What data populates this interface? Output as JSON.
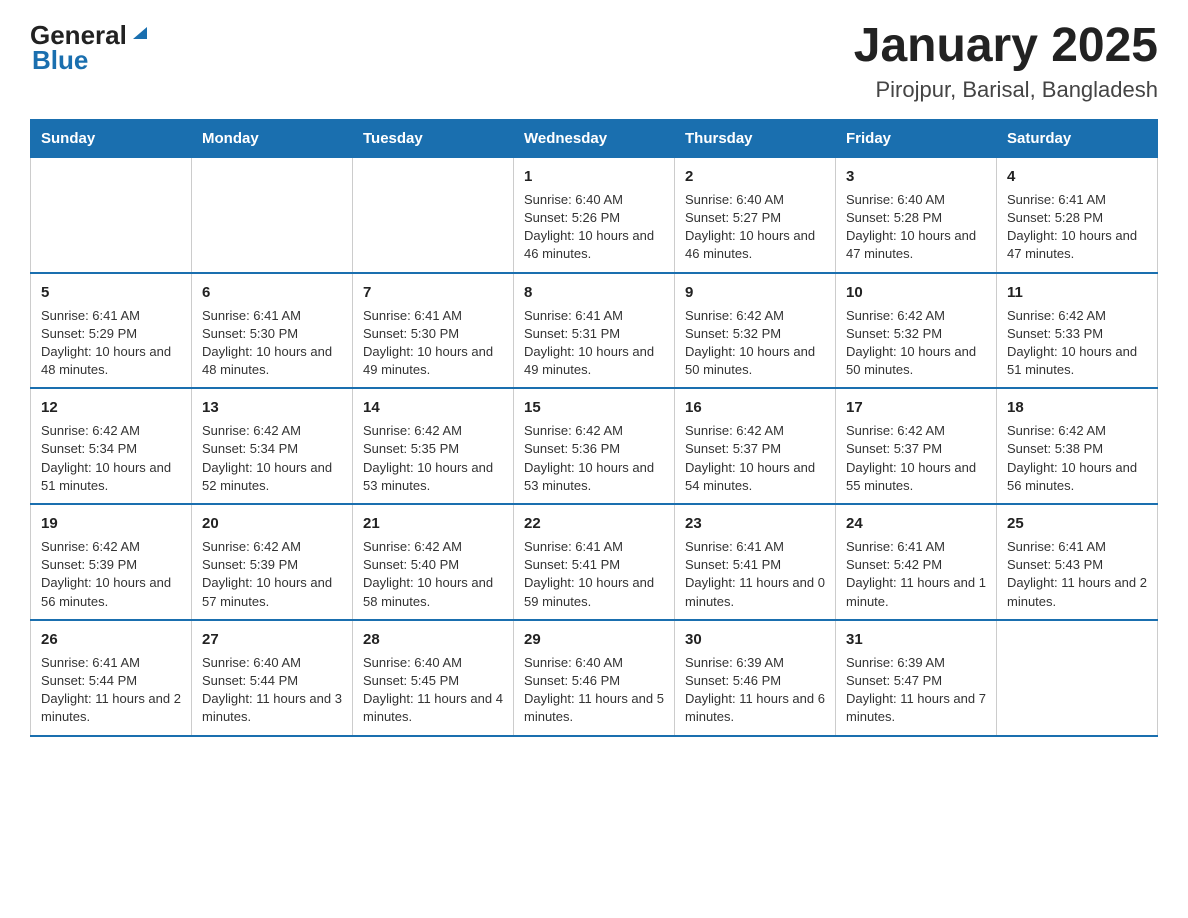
{
  "header": {
    "logo_general": "General",
    "logo_blue": "Blue",
    "title": "January 2025",
    "subtitle": "Pirojpur, Barisal, Bangladesh"
  },
  "days_of_week": [
    "Sunday",
    "Monday",
    "Tuesday",
    "Wednesday",
    "Thursday",
    "Friday",
    "Saturday"
  ],
  "weeks": [
    [
      {
        "day": "",
        "info": ""
      },
      {
        "day": "",
        "info": ""
      },
      {
        "day": "",
        "info": ""
      },
      {
        "day": "1",
        "info": "Sunrise: 6:40 AM\nSunset: 5:26 PM\nDaylight: 10 hours and 46 minutes."
      },
      {
        "day": "2",
        "info": "Sunrise: 6:40 AM\nSunset: 5:27 PM\nDaylight: 10 hours and 46 minutes."
      },
      {
        "day": "3",
        "info": "Sunrise: 6:40 AM\nSunset: 5:28 PM\nDaylight: 10 hours and 47 minutes."
      },
      {
        "day": "4",
        "info": "Sunrise: 6:41 AM\nSunset: 5:28 PM\nDaylight: 10 hours and 47 minutes."
      }
    ],
    [
      {
        "day": "5",
        "info": "Sunrise: 6:41 AM\nSunset: 5:29 PM\nDaylight: 10 hours and 48 minutes."
      },
      {
        "day": "6",
        "info": "Sunrise: 6:41 AM\nSunset: 5:30 PM\nDaylight: 10 hours and 48 minutes."
      },
      {
        "day": "7",
        "info": "Sunrise: 6:41 AM\nSunset: 5:30 PM\nDaylight: 10 hours and 49 minutes."
      },
      {
        "day": "8",
        "info": "Sunrise: 6:41 AM\nSunset: 5:31 PM\nDaylight: 10 hours and 49 minutes."
      },
      {
        "day": "9",
        "info": "Sunrise: 6:42 AM\nSunset: 5:32 PM\nDaylight: 10 hours and 50 minutes."
      },
      {
        "day": "10",
        "info": "Sunrise: 6:42 AM\nSunset: 5:32 PM\nDaylight: 10 hours and 50 minutes."
      },
      {
        "day": "11",
        "info": "Sunrise: 6:42 AM\nSunset: 5:33 PM\nDaylight: 10 hours and 51 minutes."
      }
    ],
    [
      {
        "day": "12",
        "info": "Sunrise: 6:42 AM\nSunset: 5:34 PM\nDaylight: 10 hours and 51 minutes."
      },
      {
        "day": "13",
        "info": "Sunrise: 6:42 AM\nSunset: 5:34 PM\nDaylight: 10 hours and 52 minutes."
      },
      {
        "day": "14",
        "info": "Sunrise: 6:42 AM\nSunset: 5:35 PM\nDaylight: 10 hours and 53 minutes."
      },
      {
        "day": "15",
        "info": "Sunrise: 6:42 AM\nSunset: 5:36 PM\nDaylight: 10 hours and 53 minutes."
      },
      {
        "day": "16",
        "info": "Sunrise: 6:42 AM\nSunset: 5:37 PM\nDaylight: 10 hours and 54 minutes."
      },
      {
        "day": "17",
        "info": "Sunrise: 6:42 AM\nSunset: 5:37 PM\nDaylight: 10 hours and 55 minutes."
      },
      {
        "day": "18",
        "info": "Sunrise: 6:42 AM\nSunset: 5:38 PM\nDaylight: 10 hours and 56 minutes."
      }
    ],
    [
      {
        "day": "19",
        "info": "Sunrise: 6:42 AM\nSunset: 5:39 PM\nDaylight: 10 hours and 56 minutes."
      },
      {
        "day": "20",
        "info": "Sunrise: 6:42 AM\nSunset: 5:39 PM\nDaylight: 10 hours and 57 minutes."
      },
      {
        "day": "21",
        "info": "Sunrise: 6:42 AM\nSunset: 5:40 PM\nDaylight: 10 hours and 58 minutes."
      },
      {
        "day": "22",
        "info": "Sunrise: 6:41 AM\nSunset: 5:41 PM\nDaylight: 10 hours and 59 minutes."
      },
      {
        "day": "23",
        "info": "Sunrise: 6:41 AM\nSunset: 5:41 PM\nDaylight: 11 hours and 0 minutes."
      },
      {
        "day": "24",
        "info": "Sunrise: 6:41 AM\nSunset: 5:42 PM\nDaylight: 11 hours and 1 minute."
      },
      {
        "day": "25",
        "info": "Sunrise: 6:41 AM\nSunset: 5:43 PM\nDaylight: 11 hours and 2 minutes."
      }
    ],
    [
      {
        "day": "26",
        "info": "Sunrise: 6:41 AM\nSunset: 5:44 PM\nDaylight: 11 hours and 2 minutes."
      },
      {
        "day": "27",
        "info": "Sunrise: 6:40 AM\nSunset: 5:44 PM\nDaylight: 11 hours and 3 minutes."
      },
      {
        "day": "28",
        "info": "Sunrise: 6:40 AM\nSunset: 5:45 PM\nDaylight: 11 hours and 4 minutes."
      },
      {
        "day": "29",
        "info": "Sunrise: 6:40 AM\nSunset: 5:46 PM\nDaylight: 11 hours and 5 minutes."
      },
      {
        "day": "30",
        "info": "Sunrise: 6:39 AM\nSunset: 5:46 PM\nDaylight: 11 hours and 6 minutes."
      },
      {
        "day": "31",
        "info": "Sunrise: 6:39 AM\nSunset: 5:47 PM\nDaylight: 11 hours and 7 minutes."
      },
      {
        "day": "",
        "info": ""
      }
    ]
  ]
}
